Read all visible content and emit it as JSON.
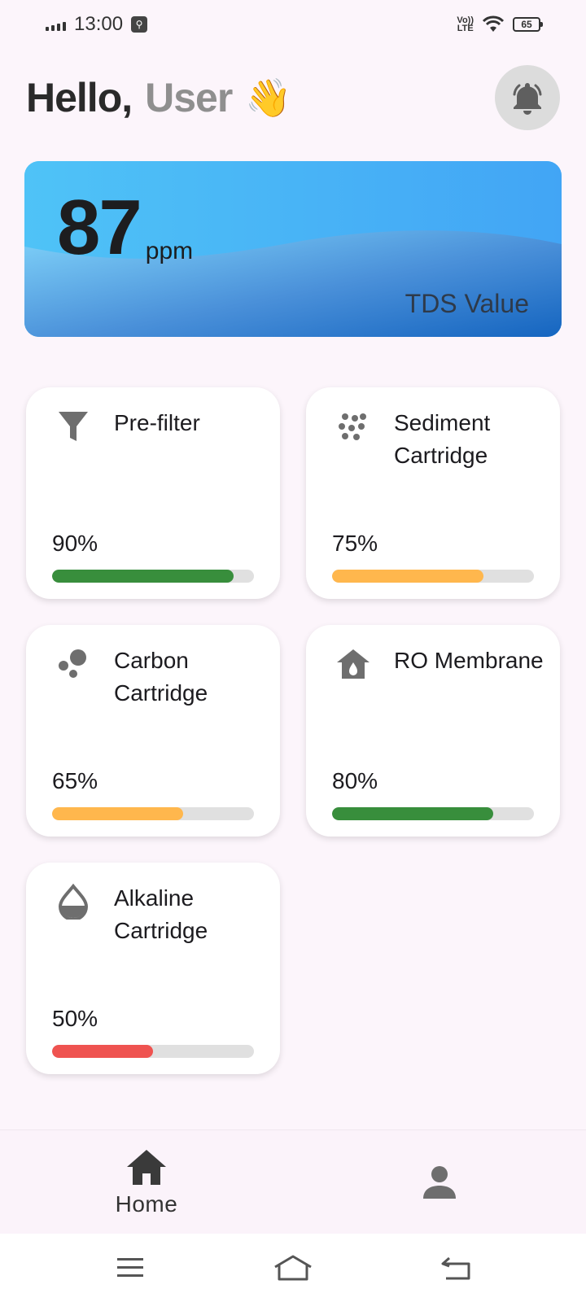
{
  "status_bar": {
    "time": "13:00",
    "usb_icon": "usb-debug-icon",
    "network_label_top": "Vo))",
    "network_label_bottom": "LTE",
    "battery": "65"
  },
  "header": {
    "greeting": "Hello,",
    "user_name": "User",
    "wave_emoji": "👋",
    "bell_icon": "bell-ringing-icon"
  },
  "tds": {
    "value": "87",
    "unit": "ppm",
    "label": "TDS Value"
  },
  "filters": [
    {
      "name": "Pre-filter",
      "percent": "90%",
      "level": 0.9,
      "color": "#388e3c",
      "icon": "funnel-icon"
    },
    {
      "name": "Sediment Cartridge",
      "percent": "75%",
      "level": 0.75,
      "color": "#ffb74d",
      "icon": "particles-icon"
    },
    {
      "name": "Carbon Cartridge",
      "percent": "65%",
      "level": 0.65,
      "color": "#ffb74d",
      "icon": "carbon-bubbles-icon"
    },
    {
      "name": "RO Membrane",
      "percent": "80%",
      "level": 0.8,
      "color": "#388e3c",
      "icon": "house-drop-icon"
    },
    {
      "name": "Alkaline Cartridge",
      "percent": "50%",
      "level": 0.5,
      "color": "#ef5350",
      "icon": "water-drop-icon"
    }
  ],
  "bottom_nav": {
    "home_label": "Home",
    "home_icon": "home-icon",
    "profile_icon": "person-icon"
  },
  "system_nav": {
    "menu_icon": "menu-icon",
    "home_icon": "system-home-icon",
    "back_icon": "back-icon"
  },
  "colors": {
    "background": "#fcf5fb",
    "tds_card_start": "#4fc3f7",
    "tds_card_end": "#1565c0",
    "good": "#388e3c",
    "warning": "#ffb74d",
    "low": "#ef5350"
  }
}
